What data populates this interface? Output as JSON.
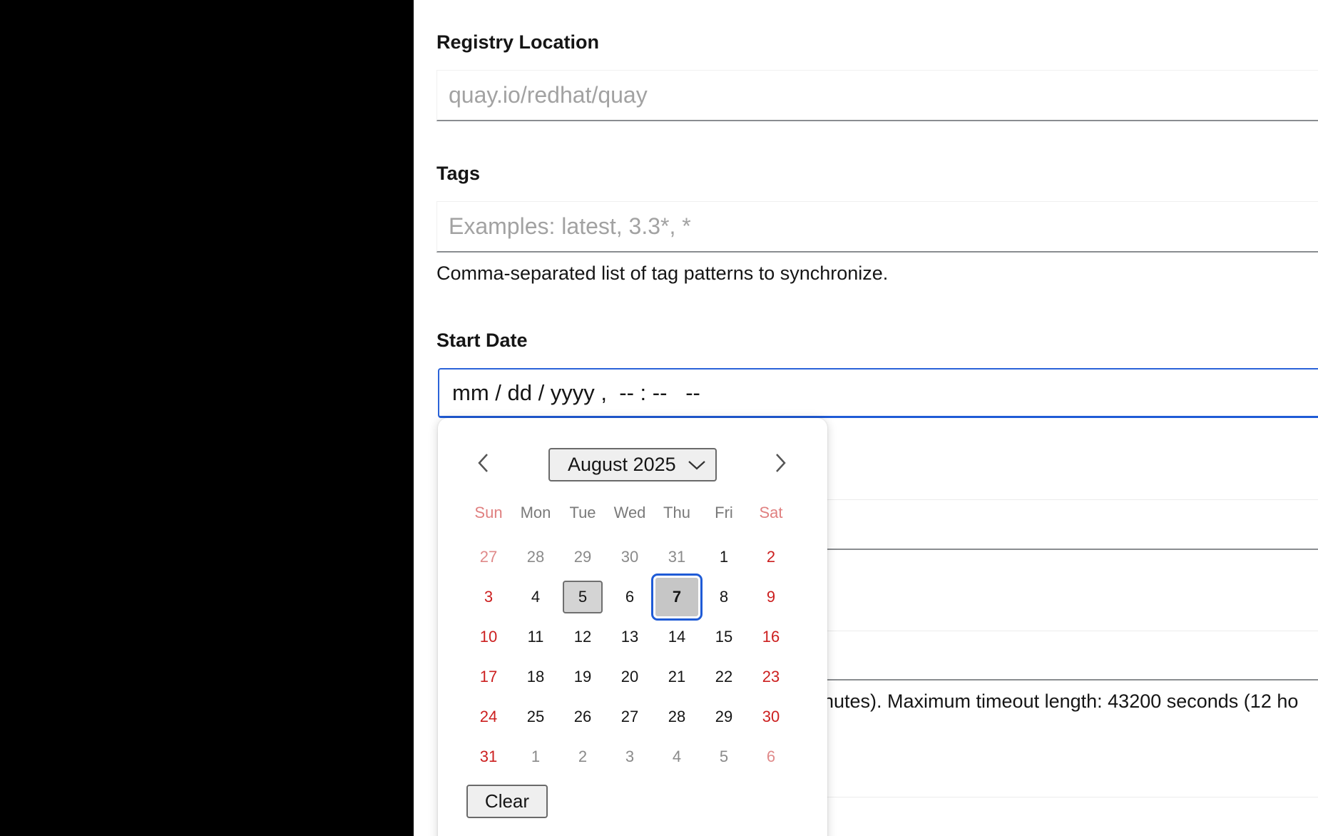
{
  "form": {
    "registry_location": {
      "label": "Registry Location",
      "placeholder": "quay.io/redhat/quay",
      "value": ""
    },
    "tags": {
      "label": "Tags",
      "placeholder": "Examples: latest, 3.3*, *",
      "value": "",
      "helper": "Comma-separated list of tag patterns to synchronize."
    },
    "start_date": {
      "label": "Start Date",
      "display": "mm / dd / yyyy ,  -- : --   --"
    },
    "timeout_helper_partial": "inutes). Maximum timeout length: 43200 seconds (12 ho"
  },
  "calendar": {
    "month_label": "August 2025",
    "prev_icon": "chevron-left-icon",
    "next_icon": "chevron-right-icon",
    "weekdays": [
      "Sun",
      "Mon",
      "Tue",
      "Wed",
      "Thu",
      "Fri",
      "Sat"
    ],
    "weeks": [
      [
        {
          "d": "27",
          "m": 1
        },
        {
          "d": "28",
          "m": 1
        },
        {
          "d": "29",
          "m": 1
        },
        {
          "d": "30",
          "m": 1
        },
        {
          "d": "31",
          "m": 1
        },
        {
          "d": "1"
        },
        {
          "d": "2"
        }
      ],
      [
        {
          "d": "3"
        },
        {
          "d": "4"
        },
        {
          "d": "5",
          "today": 1
        },
        {
          "d": "6"
        },
        {
          "d": "7",
          "selected": 1
        },
        {
          "d": "8"
        },
        {
          "d": "9"
        }
      ],
      [
        {
          "d": "10"
        },
        {
          "d": "11"
        },
        {
          "d": "12"
        },
        {
          "d": "13"
        },
        {
          "d": "14"
        },
        {
          "d": "15"
        },
        {
          "d": "16"
        }
      ],
      [
        {
          "d": "17"
        },
        {
          "d": "18"
        },
        {
          "d": "19"
        },
        {
          "d": "20"
        },
        {
          "d": "21"
        },
        {
          "d": "22"
        },
        {
          "d": "23"
        }
      ],
      [
        {
          "d": "24"
        },
        {
          "d": "25"
        },
        {
          "d": "26"
        },
        {
          "d": "27"
        },
        {
          "d": "28"
        },
        {
          "d": "29"
        },
        {
          "d": "30"
        }
      ],
      [
        {
          "d": "31"
        },
        {
          "d": "1",
          "m": 1
        },
        {
          "d": "2",
          "m": 1
        },
        {
          "d": "3",
          "m": 1
        },
        {
          "d": "4",
          "m": 1
        },
        {
          "d": "5",
          "m": 1
        },
        {
          "d": "6",
          "m": 1
        }
      ]
    ],
    "clear_label": "Clear"
  },
  "colors": {
    "focus_blue": "#1f5bd6",
    "weekend_red": "#cc1f1f",
    "left_panel": "#000000"
  }
}
